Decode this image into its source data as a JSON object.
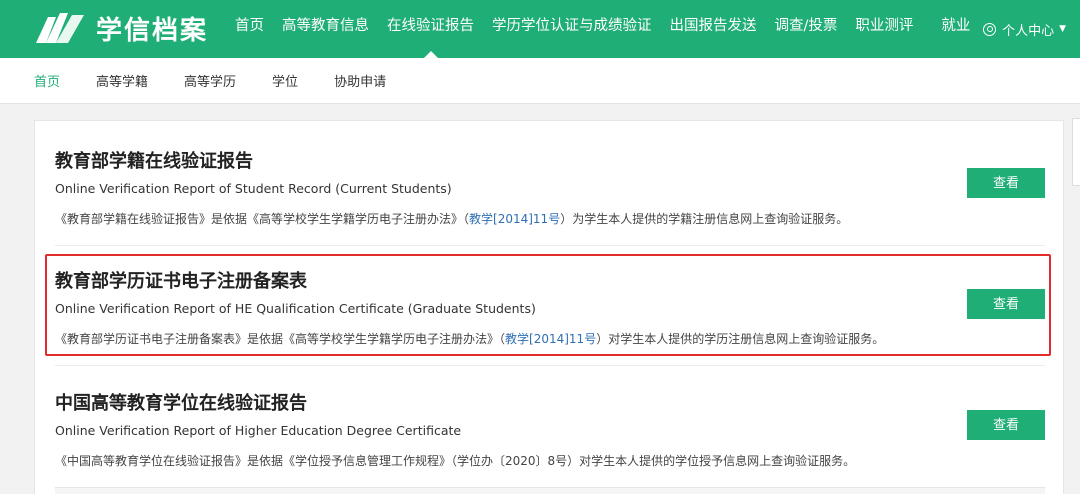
{
  "header": {
    "logo_text": "学信档案",
    "nav": [
      "首页",
      "高等教育信息",
      "在线验证报告",
      "学历学位认证与成绩验证",
      "出国报告发送",
      "调查/投票",
      "职业测评",
      "就业"
    ],
    "active_nav_index": 2,
    "user_center": "个人中心"
  },
  "subnav": {
    "items": [
      "首页",
      "高等学籍",
      "高等学历",
      "学位",
      "协助申请"
    ],
    "active_index": 0
  },
  "reports": [
    {
      "title": "教育部学籍在线验证报告",
      "en": "Online Verification Report of Student Record (Current Students)",
      "desc_pre": "《教育部学籍在线验证报告》是依据《高等学校学生学籍学历电子注册办法》（",
      "desc_link": "教学[2014]11号",
      "desc_post": "）为学生本人提供的学籍注册信息网上查询验证服务。",
      "button": "查看"
    },
    {
      "title": "教育部学历证书电子注册备案表",
      "en": "Online Verification Report of HE Qualification Certificate (Graduate Students)",
      "desc_pre": "《教育部学历证书电子注册备案表》是依据《高等学校学生学籍学历电子注册办法》（",
      "desc_link": "教学[2014]11号",
      "desc_post": "）对学生本人提供的学历注册信息网上查询验证服务。",
      "button": "查看"
    },
    {
      "title": "中国高等教育学位在线验证报告",
      "en": "Online Verification Report of Higher Education Degree Certificate",
      "desc_pre": "《中国高等教育学位在线验证报告》是依据《学位授予信息管理工作规程》（学位办〔2020〕8号）对学生本人提供的学位授予信息网上查询验证服务。",
      "desc_link": "",
      "desc_post": "",
      "button": "查看"
    }
  ],
  "colors": {
    "brand_green": "#1fae76",
    "highlight_red": "#e32b2b",
    "link_blue": "#2f6fb5"
  }
}
